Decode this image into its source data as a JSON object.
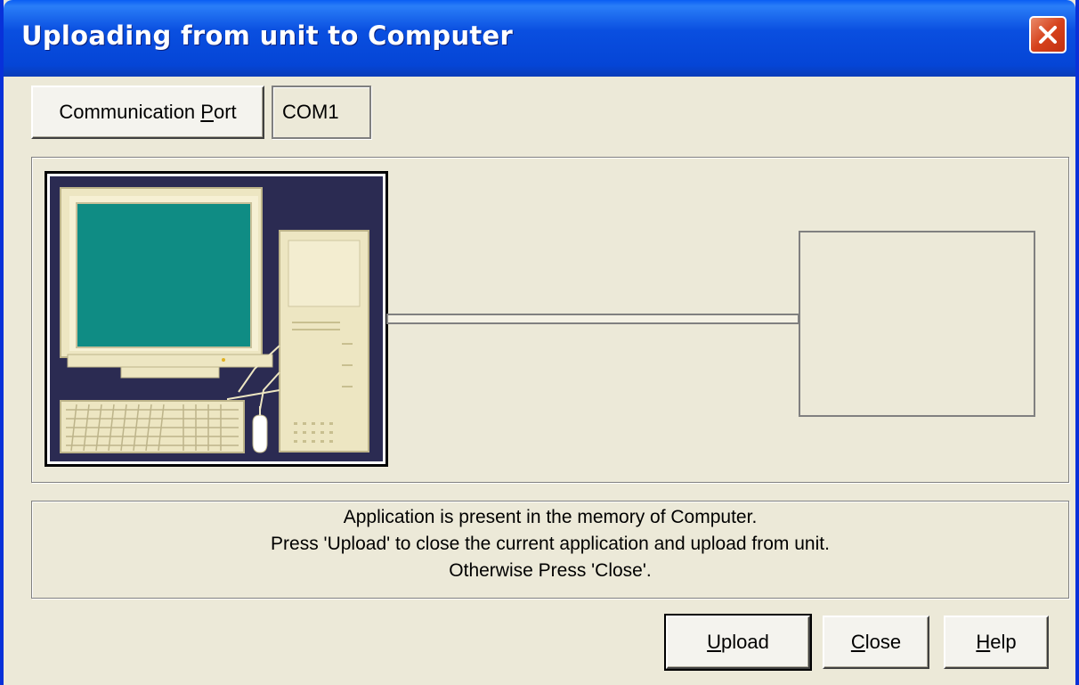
{
  "window": {
    "title": "Uploading from unit to Computer"
  },
  "port": {
    "button_label_pre": "Communication ",
    "button_label_key": "P",
    "button_label_post": "ort",
    "value": "COM1"
  },
  "message": {
    "lines": [
      "Application is present in the memory of Computer.",
      "Press 'Upload' to close the current application and upload from unit.",
      "Otherwise Press 'Close'."
    ]
  },
  "buttons": {
    "upload": {
      "key": "U",
      "rest": "pload"
    },
    "close": {
      "key": "C",
      "rest": "lose"
    },
    "help": {
      "key": "H",
      "rest": "elp"
    }
  },
  "colors": {
    "titlebar": "#0545d6",
    "dialog_bg": "#ece9d8",
    "close_button": "#d6421c",
    "monitor_screen": "#0f8c84",
    "picture_bg": "#2b2b52"
  },
  "icons": {
    "close": "close-x-icon",
    "computer": "computer-illustration"
  }
}
